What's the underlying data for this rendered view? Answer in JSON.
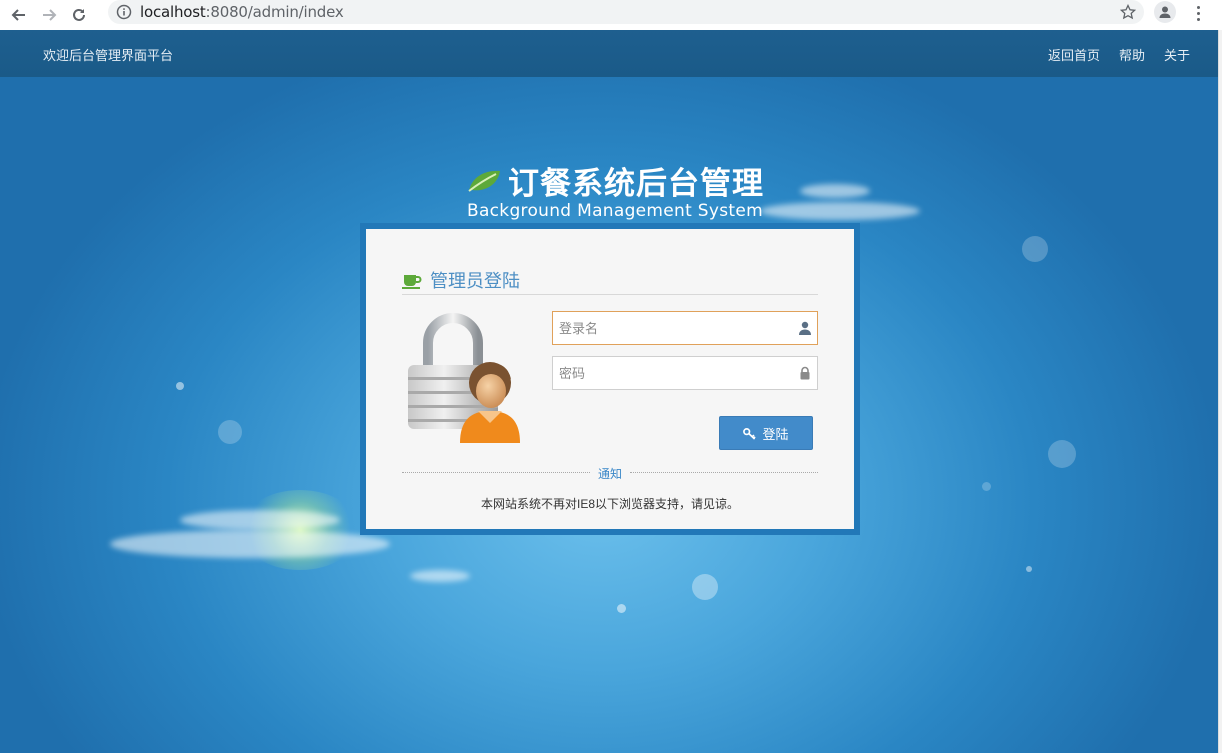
{
  "browser": {
    "url_host": "localhost",
    "url_path": ":8080/admin/index"
  },
  "topnav": {
    "welcome": "欢迎后台管理界面平台",
    "links": [
      "返回首页",
      "帮助",
      "关于"
    ]
  },
  "brand": {
    "title_cn": "订餐系统后台管理",
    "title_en": "Background Management System"
  },
  "login": {
    "title": "管理员登陆",
    "username_placeholder": "登录名",
    "password_placeholder": "密码",
    "button_label": "登陆",
    "notice_label": "通知",
    "notice_text": "本网站系统不再对IE8以下浏览器支持，请见谅。"
  },
  "colors": {
    "nav_bar": "#1a5a88",
    "card_frame": "#2278b8",
    "button": "#428bca",
    "title": "#4d8fc4",
    "active_border": "#e0a15a"
  },
  "icons": {
    "back": "arrow-left-icon",
    "forward": "arrow-right-icon",
    "reload": "reload-icon",
    "info": "info-icon",
    "bookmark": "star-icon",
    "account": "profile-icon",
    "menu": "more-vertical-icon",
    "brand": "leaf-icon",
    "card_title": "coffee-cup-icon",
    "username": "user-icon",
    "password": "lock-icon",
    "button": "key-icon"
  }
}
